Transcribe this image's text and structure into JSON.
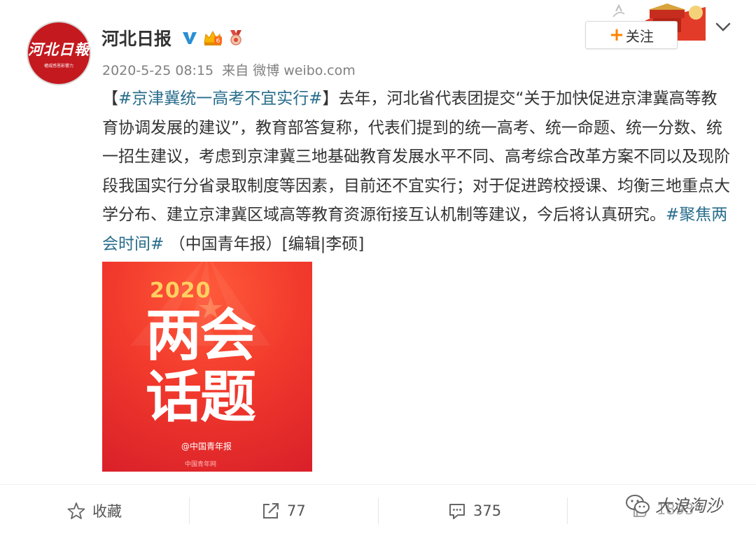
{
  "account": {
    "avatar_logo": "河北日報",
    "avatar_sub": "權威感恩影響力",
    "name": "河北日报",
    "verified_icon": "v-verified-icon",
    "vip_icon": "vip-crown-icon",
    "medal_icon": "medal-icon"
  },
  "meta": {
    "time": "2020-5-25 08:15",
    "source_prefix": "来自",
    "source": "微博 weibo.com"
  },
  "follow": {
    "plus": "+",
    "label": "关注"
  },
  "post": {
    "bracket_open": "【",
    "topic": "#京津冀统一高考不宜实行#",
    "bracket_close": "】",
    "body": "去年，河北省代表团提交“关于加快促进京津冀高等教育协调发展的建议”，教育部答复称，代表们提到的统一高考、统一命题、统一分数、统一招生建议，考虑到京津冀三地基础教育发展水平不同、高考综合改革方案不同以及现阶段我国实行分省录取制度等因素，目前还不宜实行；对于促进跨校授课、均衡三地重点大学分布、建立京津冀区域高等教育资源衔接互认机制等建议，今后将认真研究。",
    "topic2": "#聚焦两会时间#",
    "tail": "（中国青年报）[编辑|李硕]"
  },
  "image": {
    "year": "2020",
    "line1": "两会",
    "line2": "话题",
    "credit": "@中国青年报",
    "credit2": "中国青年网"
  },
  "actions": {
    "favorite_label": "收藏",
    "repost_count": "77",
    "comment_count": "375",
    "like_count": "1893"
  },
  "watermark": {
    "text": "大浪淘沙"
  },
  "colors": {
    "topic": "#286d8c",
    "follow_plus": "#ff8200",
    "brand_red": "#c4191f"
  }
}
